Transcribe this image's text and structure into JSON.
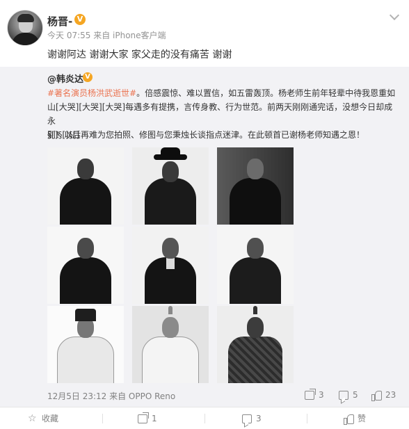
{
  "author": {
    "name": "杨晋-",
    "vip_mark": "V",
    "meta": "今天 07:55 来自 iPhone客户端"
  },
  "post_text": "谢谢阿达 谢谢大家 家父走的没有痛苦 谢谢",
  "repost": {
    "author": "@韩炎达",
    "vip_mark": "V",
    "hashtag": "#著名演员杨洪武逝世#",
    "line1_rest": "。倍感震惊、难以置信，如五雷轰顶。杨老师生前年轻辈中待我恩重如",
    "line2": "山[大哭][大哭][大哭]每遇多有提携，言传身教、行为世范。前两天刚刚通完话，没想今日却成永",
    "line3": "别！以后再难为您拍照、修图与您秉烛长谈指点迷津。在此顿首已谢杨老师知遇之恩！",
    "emoji_line": "§[]§[]§[]",
    "footer": "12月5日 23:12 来自 OPPO Reno",
    "share_count": "3",
    "comment_count": "5",
    "like_count": "23"
  },
  "bottom_bar": {
    "favorite_label": "收藏",
    "share_count": "1",
    "comment_count": "3",
    "like_label": "赞"
  },
  "icons": [
    "more-chevron-icon",
    "share-icon",
    "comment-icon",
    "like-icon",
    "star-icon"
  ],
  "colors": {
    "hashtag": "#eb7350",
    "vip_badge": "#f5a623",
    "repost_background": "#f2f2f5"
  }
}
